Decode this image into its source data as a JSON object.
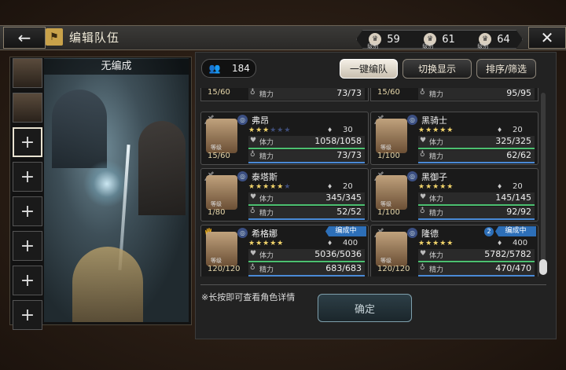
{
  "header": {
    "title": "编辑队伍",
    "back_icon": "back-arrow-icon",
    "close_icon": "close-icon"
  },
  "stats": [
    {
      "label": "级别",
      "value": "59"
    },
    {
      "label": "级别",
      "value": "61"
    },
    {
      "label": "级别",
      "value": "64"
    }
  ],
  "party": {
    "name": "无编成",
    "slots": [
      "portrait",
      "portrait",
      "add",
      "add",
      "add",
      "add",
      "add",
      "add"
    ],
    "add_symbol": "+"
  },
  "roster": {
    "count": "184"
  },
  "buttons": {
    "auto": "一键编队",
    "switch": "切换显示",
    "sort": "排序/筛选",
    "confirm": "确定"
  },
  "labels": {
    "hp": "体力",
    "sp": "精力",
    "level": "等级",
    "in_party": "编成中"
  },
  "partial": [
    {
      "level": "15/60",
      "sp": "73/73"
    },
    {
      "level": "15/60",
      "sp": "95/95"
    }
  ],
  "cards": [
    {
      "name": "弗昂",
      "stars": "★★★",
      "stars_off": "★★★",
      "jp": "30",
      "hp": "1058/1058",
      "sp": "73/73",
      "level": "15/60",
      "tag": "",
      "num": ""
    },
    {
      "name": "黑骑士",
      "stars": "★★★★★",
      "stars_off": "",
      "jp": "20",
      "hp": "325/325",
      "sp": "62/62",
      "level": "1/100",
      "tag": "",
      "num": ""
    },
    {
      "name": "泰塔斯",
      "stars": "★★★★★",
      "stars_off": "★",
      "jp": "20",
      "hp": "345/345",
      "sp": "52/52",
      "level": "1/80",
      "tag": "",
      "num": ""
    },
    {
      "name": "黑御子",
      "stars": "★★★★★",
      "stars_off": "",
      "jp": "20",
      "hp": "145/145",
      "sp": "92/92",
      "level": "1/100",
      "tag": "",
      "num": ""
    },
    {
      "name": "希格娜",
      "stars": "★★★★★",
      "stars_off": "",
      "jp": "400",
      "hp": "5036/5036",
      "sp": "683/683",
      "level": "120/120",
      "tag": "编成中",
      "num": ""
    },
    {
      "name": "隆德",
      "stars": "★★★★★",
      "stars_off": "",
      "jp": "400",
      "hp": "5782/5782",
      "sp": "470/470",
      "level": "120/120",
      "tag": "编成中",
      "num": "2"
    }
  ],
  "hint": "※长按即可查看角色详情"
}
